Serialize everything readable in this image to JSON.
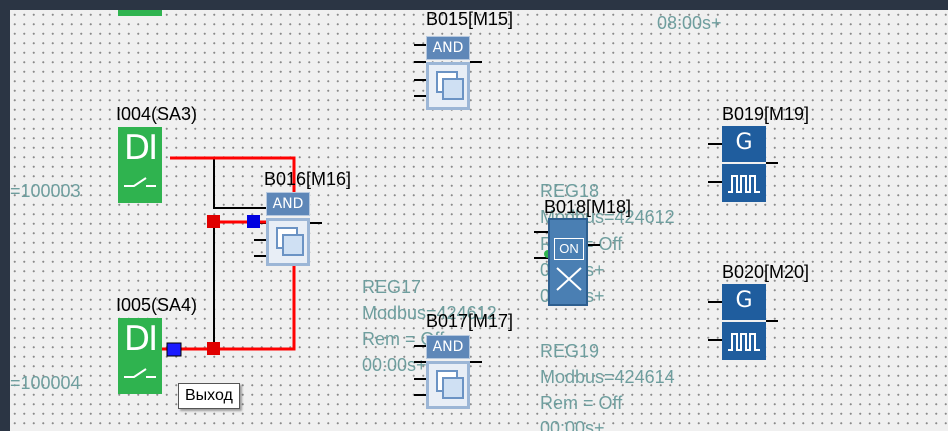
{
  "blocks": {
    "b015": {
      "name": "B015[M15]",
      "type_label": "AND"
    },
    "b016": {
      "name": "B016[M16]",
      "type_label": "AND"
    },
    "b017": {
      "name": "B017[M17]",
      "type_label": "AND"
    },
    "b018": {
      "name": "B018[M18]",
      "type_label": "ON"
    },
    "b019": {
      "name": "B019[M19]",
      "type_label": "G"
    },
    "b020": {
      "name": "B020[M20]",
      "type_label": "G"
    },
    "i004": {
      "name": "I004(SA3)",
      "type_label": "DI",
      "address": "=100003"
    },
    "i005": {
      "name": "I005(SA4)",
      "type_label": "DI",
      "address": "=100004"
    }
  },
  "registers": {
    "top_time": "08:00s+",
    "reg17": {
      "name": "REG17",
      "modbus": "Modbus=424612",
      "rem": "Rem = Off",
      "time": "00:00s+"
    },
    "reg18": {
      "name": "REG18",
      "modbus": "Modbus=424612",
      "rem": "Rem = Off",
      "time1": "00:00s+",
      "time2": "00:00s+"
    },
    "reg19": {
      "name": "REG19",
      "modbus": "Modbus=424614",
      "rem": "Rem = Off",
      "time": "00:00s+"
    }
  },
  "tooltip": "Выход",
  "colors": {
    "frame": "#2b3544",
    "canvas": "#f0f0f0",
    "wire_active": "#ff0000",
    "wire": "#000000",
    "di_green": "#2fb34f",
    "gate_blue": "#5e87b8",
    "gen_blue": "#1f5d9e",
    "ghost_text": "#6e9e9e"
  }
}
